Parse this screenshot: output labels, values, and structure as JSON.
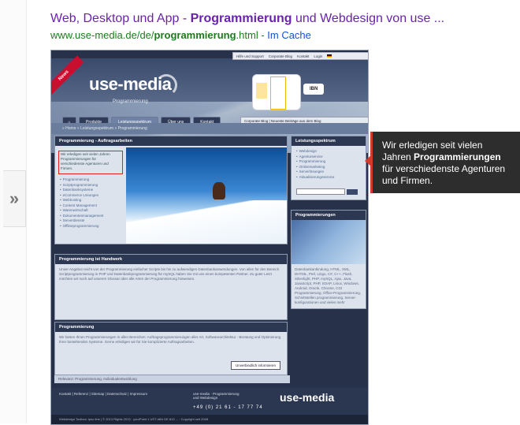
{
  "result": {
    "title_pre": "Web, Desktop und App - ",
    "title_bold": "Programmierung",
    "title_post": " und Webdesign von use ...",
    "url_pre": "www.use-media.de/de/",
    "url_bold": "programmierung",
    "url_post": ".html",
    "url_sep": " - ",
    "cache_label": "Im Cache"
  },
  "sidebar_toggle": "»",
  "site": {
    "topbar": [
      "Hilfe und Support",
      "Corporate Blog",
      "Kontakt",
      "Login"
    ],
    "news": "News",
    "logo": "use-media",
    "tagline": "Programmierung",
    "ibn": "IBN",
    "nav": [
      "⌂",
      "Produkte",
      "Leistungsspektrum",
      "Über uns",
      "Kontakt"
    ],
    "corporate_blog": "Corporate Blog | Neueste Beiträge aus dem Blog",
    "breadcrumb": "» Home  » Leistungsspektrum  » Programmierung",
    "main1_title": "Programmierung - Auftragsarbeiten",
    "redbox_text": "Wir erledigen seit vielen Jahren Programmierungen für verschiedenste Agenturen und Firmen.",
    "main1_list": [
      "Programmierung",
      "Scriptprogrammierung",
      "Datenbanksysteme",
      "eCommerce Lösungen",
      "Webhosting",
      "Content Management",
      "Warenwirtschaft",
      "Dokumentenmanagement",
      "Serverdienste",
      "Offlineprogrammierung"
    ],
    "main2_title": "Programmierung ist Handwerk",
    "main2_text": "Unser Angebot reicht von der Programmierung einfacher Scripte bis hin zu aufwendigen Datenbankanwendungen. Von allen für den Bereich Scriptprogrammierung in PHP und Datenbankprogrammierung für mySQL haben Sie mit uns einen kompetenten Partner. Zu guter Letzt möchten wir noch auf unseren Glossar über alle Arten der Programmierung hinweisen.",
    "main3_title": "Programmierung",
    "main3_text": "Wir bieten Ihnen Programmierungen in allen Bereichen: Auftragsprogrammierungen aller Art, Softwarearchitektur - Beratung und Optimierung Ihrer bestehenden Systeme. Gerne erledigen wir für Sie komplizierte Auftragsarbeiten.",
    "main3_button": "Unverbindlich informieren",
    "footer_bar": "Relevanz: Programmierung, Individualentwicklung",
    "footer_links": "Kontakt | Referenz | Sitemap | Datenschutz | Impressum",
    "footer_mid": "use-media · Programmierung und Webdesign",
    "footer_phone": "+49 (0) 21 61 - 17 77 74",
    "footer_logo": "use-media",
    "subfooter": "Webdesign Toolbox: ipso fine | © 2013 Rights 2013 · yourPoint 1 UST-IdNr DE 813 ... · Copyright seit 2008",
    "side1_title": "Leistungsspektrum",
    "side1_list": [
      "Webdesign",
      "Agenturservice",
      "Programmierung",
      "Onlinemarketing",
      "Serverlösungen",
      "Aktualisierungsservice"
    ],
    "side2_title": "Programmierungen",
    "side2_text": "Datenbankanbindung, HTML, XML, DHTML, Perl, Lingo, C#, C++, Flash, Silverlight, PHP, mySQL, Ajax, Java, JavaScript, PHP, SOAP, Linux, Windows, Android, Oracle, Chrome, CGI Programmierung, Office-Programmierung, Schnittstellen programmierung, Server-konfigurationen und vieles mehr"
  },
  "tooltip": {
    "pre": "Wir erledigen seit vielen Jahren ",
    "bold": "Programmierungen",
    "post": " für verschiedenste Agenturen und Firmen."
  }
}
